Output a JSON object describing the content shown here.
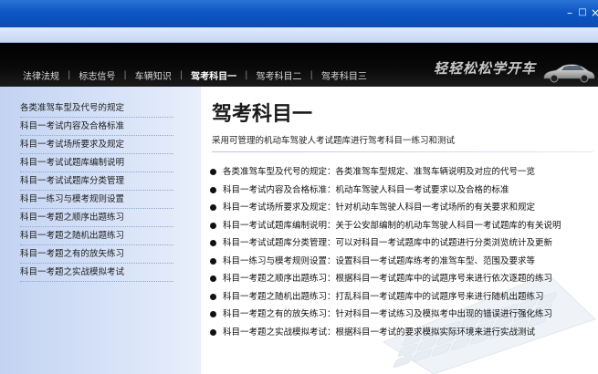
{
  "window": {
    "minimize_glyph": "–",
    "maximize_glyph": "□",
    "close_glyph": "×",
    "titlebar_color": "#0d56c4"
  },
  "nav": {
    "items": [
      {
        "label": "法律法规",
        "active": false
      },
      {
        "label": "标志信号",
        "active": false
      },
      {
        "label": "车辆知识",
        "active": false
      },
      {
        "label": "驾考科目一",
        "active": true
      },
      {
        "label": "驾考科目二",
        "active": false
      },
      {
        "label": "驾考科目三",
        "active": false
      }
    ],
    "separator": "|",
    "slogan": "轻轻松松学开车",
    "car_icon": "car-icon"
  },
  "sidebar": {
    "items": [
      {
        "label": "各类准驾车型及代号的规定"
      },
      {
        "label": "科目一考试内容及合格标准"
      },
      {
        "label": "科目一考试场所要求及规定"
      },
      {
        "label": "科目一考试试题库编制说明"
      },
      {
        "label": "科目一考试试题库分类管理"
      },
      {
        "label": "科目一练习与模考规则设置"
      },
      {
        "label": "科目一考题之顺序出题练习"
      },
      {
        "label": "科目一考题之随机出题练习"
      },
      {
        "label": "科目一考题之有的放矢练习"
      },
      {
        "label": "科目一考题之实战模拟考试"
      }
    ]
  },
  "main": {
    "title": "驾考科目一",
    "subtitle": "采用可管理的机动车驾驶人考试题库进行驾考科目一练习和测试",
    "items": [
      {
        "text": "各类准驾车型及代号的规定：各类准驾车型规定、准驾车辆说明及对应的代号一览"
      },
      {
        "text": "科目一考试内容及合格标准：机动车驾驶人科目一考试要求以及合格的标准"
      },
      {
        "text": "科目一考试场所要求及规定：针对机动车驾驶人科目一考试场所的有关要求和规定"
      },
      {
        "text": "科目一考试试题库编制说明：关于公安部编制的机动车驾驶人科目一考试题库的有关说明"
      },
      {
        "text": "科目一考试试题库分类管理：可以对科目一考试题库中的试题进行分类浏览统计及更新"
      },
      {
        "text": "科目一练习与模考规则设置：设置科目一考试题库练考的准驾车型、范围及要求等"
      },
      {
        "text": "科目一考题之顺序出题练习：根据科目一考试题库中的试题序号来进行依次逐题的练习"
      },
      {
        "text": "科目一考题之随机出题练习：打乱科目一考试题库中的试题序号来进行随机出题练习"
      },
      {
        "text": "科目一考题之有的放矢练习：针对科目一考试练习及模拟考中出现的错误进行强化练习"
      },
      {
        "text": "科目一考题之实战模拟考试：根据科目一考试的要求模拟实际环境来进行实战测试"
      }
    ],
    "decor_icon": "keyboard-icon"
  }
}
